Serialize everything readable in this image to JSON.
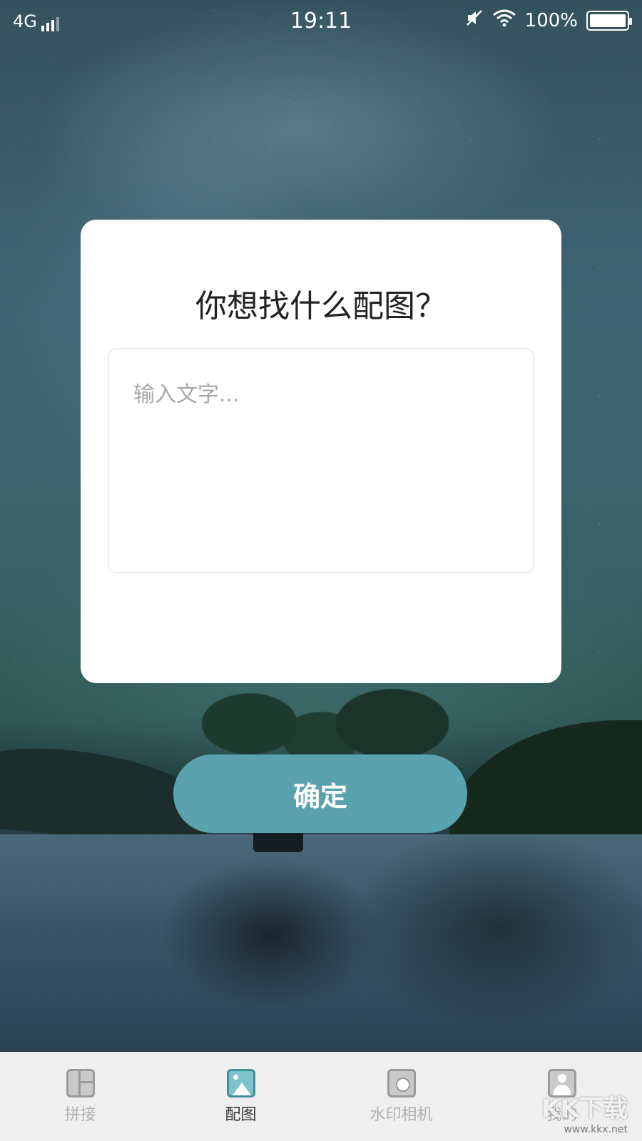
{
  "status_bar": {
    "network": "4G",
    "time": "19:11",
    "battery_percent": "100%"
  },
  "dialog": {
    "title": "你想找什么配图？",
    "input_placeholder": "输入文字...",
    "input_value": ""
  },
  "confirm_label": "确定",
  "bottom_nav": {
    "items": [
      {
        "label": "拼接",
        "icon": "collage-icon",
        "active": false
      },
      {
        "label": "配图",
        "icon": "image-icon",
        "active": true
      },
      {
        "label": "水印相机",
        "icon": "camera-icon",
        "active": false
      },
      {
        "label": "我的",
        "icon": "profile-icon",
        "active": false
      }
    ]
  },
  "watermark": {
    "text": "KK下载",
    "url": "www.kkx.net"
  },
  "colors": {
    "accent": "#5aa3ae",
    "nav_background": "#efefef"
  }
}
